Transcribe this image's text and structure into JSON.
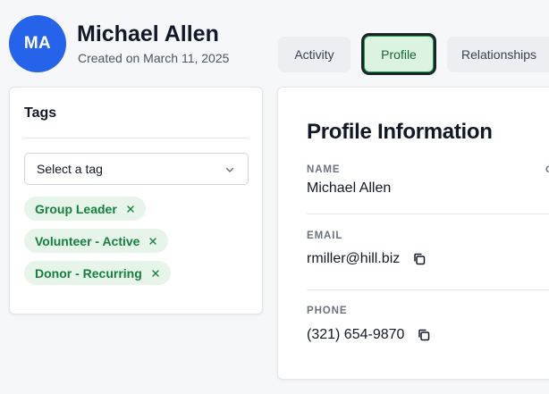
{
  "header": {
    "avatar_initials": "MA",
    "avatar_color": "#2563eb",
    "name": "Michael Allen",
    "created": "Created on March 11, 2025"
  },
  "tabs": [
    {
      "label": "Activity",
      "active": false
    },
    {
      "label": "Profile",
      "active": true
    },
    {
      "label": "Relationships",
      "active": false
    }
  ],
  "tags": {
    "title": "Tags",
    "select_value": "Select a tag",
    "items": [
      {
        "label": "Group Leader",
        "remove_icon": "close-icon"
      },
      {
        "label": "Volunteer - Active",
        "remove_icon": "close-icon"
      },
      {
        "label": "Donor - Recurring",
        "remove_icon": "close-icon"
      }
    ],
    "chip_color": "#15803d"
  },
  "profile": {
    "title": "Profile Information",
    "second_column_label_partial": "C",
    "fields": [
      {
        "label": "NAME",
        "value": "Michael Allen"
      },
      {
        "label": "EMAIL",
        "value": "rmiller@hill.biz",
        "icon": "copy-icon"
      },
      {
        "label": "PHONE",
        "value": "(321) 654-9870",
        "icon": "copy-icon"
      }
    ]
  }
}
